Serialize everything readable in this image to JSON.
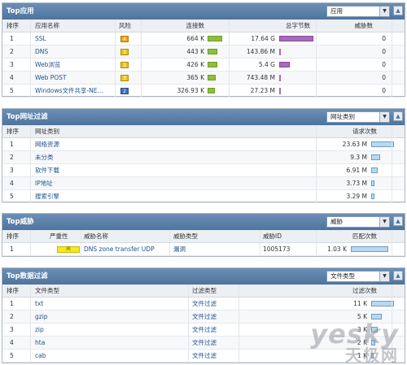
{
  "apps": {
    "title": "Top应用",
    "select": "应用",
    "collapse": "▲",
    "headers": [
      "排序",
      "应用名称",
      "风险",
      "连接数",
      "总字节数",
      "威胁数"
    ],
    "rows": [
      {
        "rank": "1",
        "name": "SSL",
        "risk": "4",
        "conn": "664 K",
        "bytes": "17.64 G",
        "threats": "0",
        "conn_frac": 0.9,
        "bytes_frac": 1.0
      },
      {
        "rank": "2",
        "name": "DNS",
        "risk": "3",
        "conn": "443 K",
        "bytes": "143.86 M",
        "threats": "0",
        "conn_frac": 0.6,
        "bytes_frac": 0.02
      },
      {
        "rank": "3",
        "name": "Web浏览",
        "risk": "3",
        "conn": "426 K",
        "bytes": "5.4 G",
        "threats": "0",
        "conn_frac": 0.58,
        "bytes_frac": 0.32
      },
      {
        "rank": "4",
        "name": "Web POST",
        "risk": "3",
        "conn": "365 K",
        "bytes": "743.48 M",
        "threats": "0",
        "conn_frac": 0.5,
        "bytes_frac": 0.05
      },
      {
        "rank": "5",
        "name": "Windows文件共享-NE...",
        "risk": "2",
        "conn": "326.93 K",
        "bytes": "27.23 M",
        "threats": "0",
        "conn_frac": 0.45,
        "bytes_frac": 0.01
      }
    ]
  },
  "urls": {
    "title": "Top网址过滤",
    "select": "网址类别",
    "collapse": "▲",
    "headers": [
      "排序",
      "网址类别",
      "请求次数"
    ],
    "rows": [
      {
        "rank": "1",
        "name": "网络资源",
        "count": "23.63 M",
        "frac": 1.0
      },
      {
        "rank": "2",
        "name": "未分类",
        "count": "9.3 M",
        "frac": 0.39
      },
      {
        "rank": "3",
        "name": "软件下载",
        "count": "6.91 M",
        "frac": 0.29
      },
      {
        "rank": "4",
        "name": "IP地址",
        "count": "3.73 M",
        "frac": 0.16
      },
      {
        "rank": "5",
        "name": "搜索引擎",
        "count": "3.29 M",
        "frac": 0.14
      }
    ]
  },
  "threats": {
    "title": "Top威胁",
    "select": "威胁",
    "collapse": "▲",
    "headers": [
      "排序",
      "严重性",
      "威胁名称",
      "威胁类型",
      "威胁ID",
      "匹配次数"
    ],
    "rows": [
      {
        "rank": "1",
        "severity": "高",
        "name": "DNS zone transfer UDP",
        "type": "漏洞",
        "id": "1005173",
        "count": "1.03 K",
        "frac": 1.0
      }
    ]
  },
  "files": {
    "title": "Top数据过滤",
    "select": "文件类型",
    "collapse": "▲",
    "headers": [
      "排序",
      "文件类型",
      "过滤类型",
      "过滤次数"
    ],
    "rows": [
      {
        "rank": "1",
        "name": "txt",
        "type": "文件过滤",
        "count": "11 K",
        "frac": 1.0
      },
      {
        "rank": "2",
        "name": "gzip",
        "type": "文件过滤",
        "count": "5 K",
        "frac": 0.45
      },
      {
        "rank": "3",
        "name": "zip",
        "type": "文件过滤",
        "count": "3 K",
        "frac": 0.27
      },
      {
        "rank": "4",
        "name": "hta",
        "type": "文件过滤",
        "count": "2 K",
        "frac": 0.18
      },
      {
        "rank": "5",
        "name": "cab",
        "type": "文件过滤",
        "count": "1 K",
        "frac": 0.09
      }
    ]
  },
  "watermark": {
    "line1": "yesky",
    "line2": "天极网"
  },
  "colors": {
    "header": "#5a7fa8",
    "bar_green": "#8fbe3c",
    "bar_purple": "#a66bb9",
    "bar_blue": "#b8d8ef",
    "link": "#1f4f8c"
  }
}
